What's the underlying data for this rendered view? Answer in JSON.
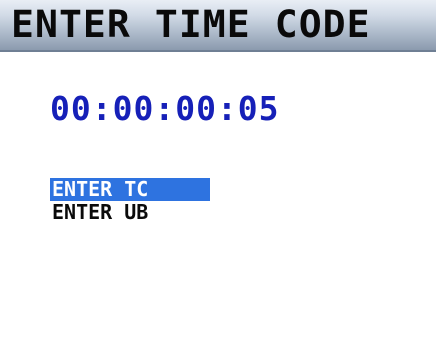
{
  "header": {
    "title": "ENTER TIME CODE"
  },
  "timecode": {
    "value": "00:00:00:05"
  },
  "menu": {
    "items": [
      {
        "label": "ENTER TC",
        "selected": true
      },
      {
        "label": "ENTER UB",
        "selected": false
      }
    ]
  },
  "colors": {
    "timecode_text": "#1620b8",
    "selection_highlight": "#2e73e0",
    "title_bar_gradient_top": "#e9eef5",
    "title_bar_gradient_bottom": "#8b9aae"
  }
}
